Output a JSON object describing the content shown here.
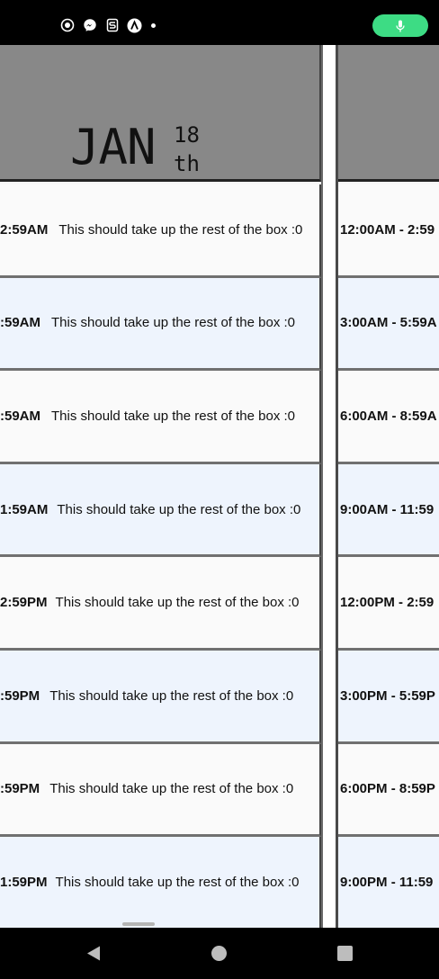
{
  "status_bar": {
    "icons": [
      "screen-record-icon",
      "messenger-icon",
      "tasker-icon",
      "app-a-icon",
      "notification-dot-icon"
    ],
    "mic_indicator": "mic-icon",
    "mic_color": "#3ddc84"
  },
  "day1": {
    "month": "JAN",
    "day": "18",
    "suffix": "th",
    "slots": [
      {
        "time": "2:59AM",
        "desc": "This should take up the rest of the box :0"
      },
      {
        "time": ":59AM",
        "desc": "This should take up the rest of the box :0"
      },
      {
        "time": ":59AM",
        "desc": "This should take up the rest of the box :0"
      },
      {
        "time": "1:59AM",
        "desc": "This should take up the rest of the box :0"
      },
      {
        "time": "2:59PM",
        "desc": "This should take up the rest of the box :0"
      },
      {
        "time": ":59PM",
        "desc": "This should take up the rest of the box :0"
      },
      {
        "time": ":59PM",
        "desc": "This should take up the rest of the box :0"
      },
      {
        "time": "1:59PM",
        "desc": "This should take up the rest of the box :0"
      }
    ]
  },
  "day2": {
    "slots": [
      {
        "time": "12:00AM - 2:59"
      },
      {
        "time": "3:00AM - 5:59A"
      },
      {
        "time": "6:00AM - 8:59A"
      },
      {
        "time": "9:00AM - 11:59"
      },
      {
        "time": "12:00PM - 2:59"
      },
      {
        "time": "3:00PM - 5:59P"
      },
      {
        "time": "6:00PM - 8:59P"
      },
      {
        "time": "9:00PM - 11:59"
      }
    ]
  },
  "nav_bar": {
    "back": "back-icon",
    "home": "home-icon",
    "recents": "recents-icon"
  },
  "colors": {
    "header_bg": "#888888",
    "slot_light": "#fafafa",
    "slot_blue": "#eef4fd",
    "divider": "#707070"
  }
}
